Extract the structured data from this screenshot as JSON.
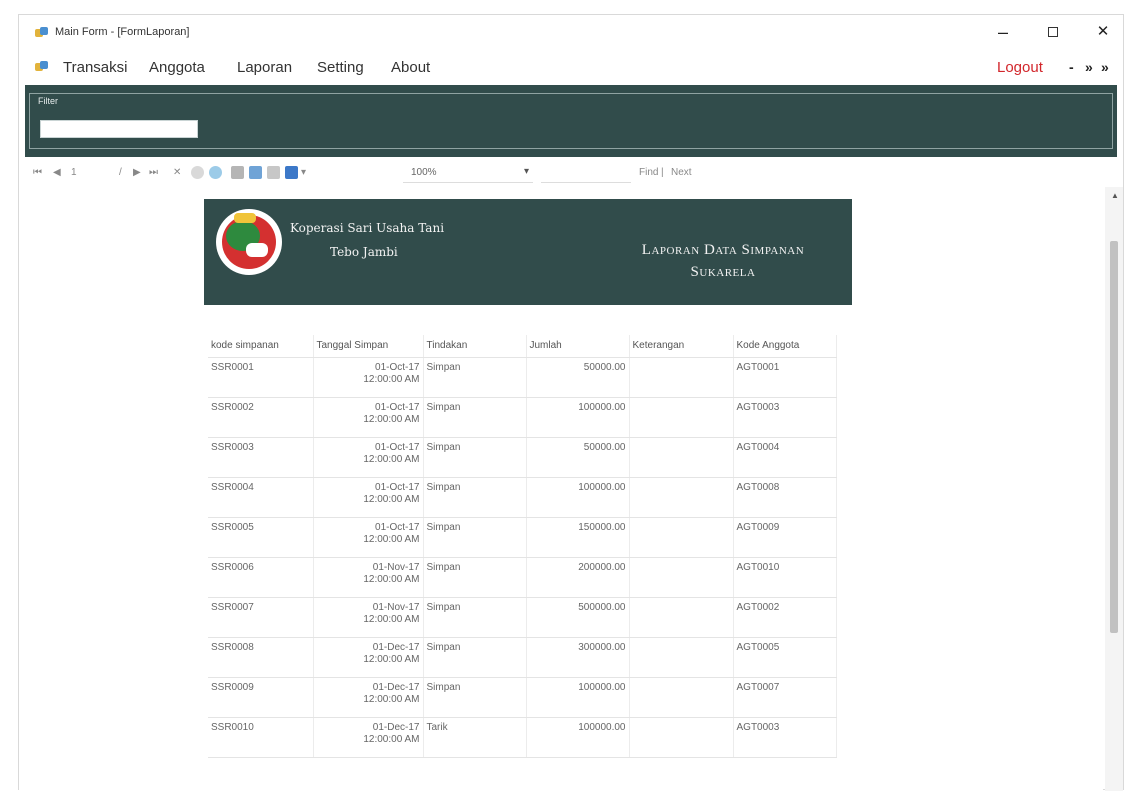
{
  "window": {
    "title": "Main Form - [FormLaporan]"
  },
  "menu": {
    "items": [
      "Transaksi",
      "Anggota",
      "Laporan",
      "Setting",
      "About"
    ],
    "logout": "Logout",
    "mdi_controls": [
      "-",
      "»",
      "»"
    ]
  },
  "filter": {
    "legend": "Filter",
    "value": ""
  },
  "toolbar": {
    "page": "1",
    "zoom": "100%",
    "find": "Find",
    "next": "Next"
  },
  "report": {
    "org_name": "Koperasi Sari Usaha Tani",
    "org_city": "Tebo Jambi",
    "title_line1": "Laporan Data Simpanan",
    "title_line2": "Sukarela",
    "columns": [
      "kode simpanan",
      "Tanggal Simpan",
      "Tindakan",
      "Jumlah",
      "Keterangan",
      "Kode Anggota"
    ],
    "rows": [
      {
        "kode": "SSR0001",
        "date": "01-Oct-17",
        "time": "12:00:00 AM",
        "tindakan": "Simpan",
        "jumlah": "50000.00",
        "keterangan": "",
        "anggota": "AGT0001"
      },
      {
        "kode": "SSR0002",
        "date": "01-Oct-17",
        "time": "12:00:00 AM",
        "tindakan": "Simpan",
        "jumlah": "100000.00",
        "keterangan": "",
        "anggota": "AGT0003"
      },
      {
        "kode": "SSR0003",
        "date": "01-Oct-17",
        "time": "12:00:00 AM",
        "tindakan": "Simpan",
        "jumlah": "50000.00",
        "keterangan": "",
        "anggota": "AGT0004"
      },
      {
        "kode": "SSR0004",
        "date": "01-Oct-17",
        "time": "12:00:00 AM",
        "tindakan": "Simpan",
        "jumlah": "100000.00",
        "keterangan": "",
        "anggota": "AGT0008"
      },
      {
        "kode": "SSR0005",
        "date": "01-Oct-17",
        "time": "12:00:00 AM",
        "tindakan": "Simpan",
        "jumlah": "150000.00",
        "keterangan": "",
        "anggota": "AGT0009"
      },
      {
        "kode": "SSR0006",
        "date": "01-Nov-17",
        "time": "12:00:00 AM",
        "tindakan": "Simpan",
        "jumlah": "200000.00",
        "keterangan": "",
        "anggota": "AGT0010"
      },
      {
        "kode": "SSR0007",
        "date": "01-Nov-17",
        "time": "12:00:00 AM",
        "tindakan": "Simpan",
        "jumlah": "500000.00",
        "keterangan": "",
        "anggota": "AGT0002"
      },
      {
        "kode": "SSR0008",
        "date": "01-Dec-17",
        "time": "12:00:00 AM",
        "tindakan": "Simpan",
        "jumlah": "300000.00",
        "keterangan": "",
        "anggota": "AGT0005"
      },
      {
        "kode": "SSR0009",
        "date": "01-Dec-17",
        "time": "12:00:00 AM",
        "tindakan": "Simpan",
        "jumlah": "100000.00",
        "keterangan": "",
        "anggota": "AGT0007"
      },
      {
        "kode": "SSR0010",
        "date": "01-Dec-17",
        "time": "12:00:00 AM",
        "tindakan": "Tarik",
        "jumlah": "100000.00",
        "keterangan": "",
        "anggota": "AGT0003"
      }
    ]
  },
  "colors": {
    "panel": "#314c4b",
    "logout": "#d2262b"
  }
}
